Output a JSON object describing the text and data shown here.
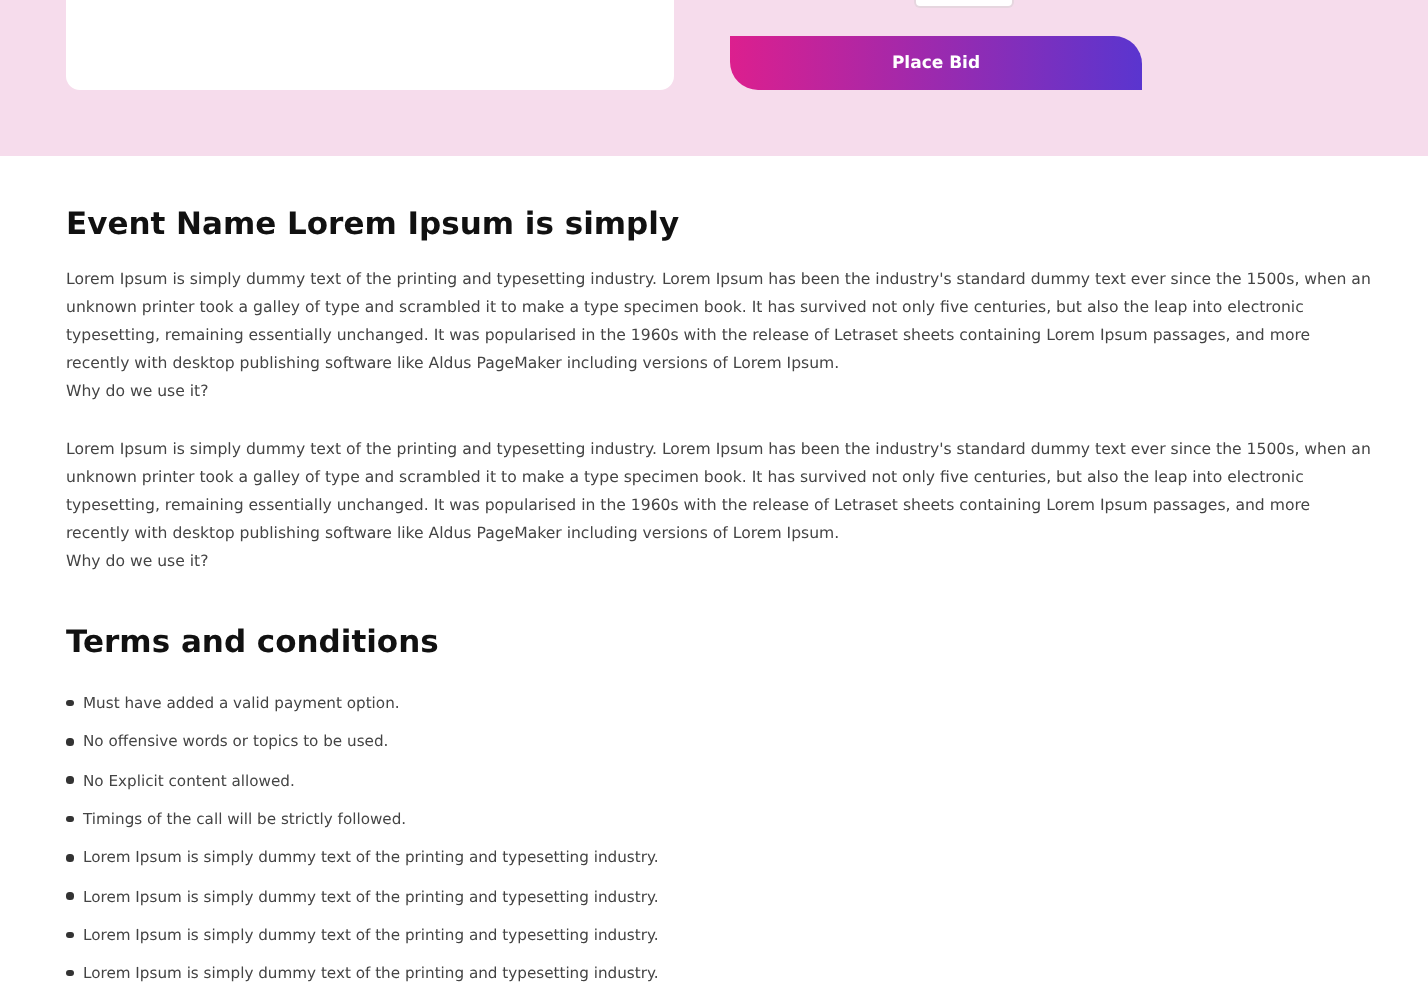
{
  "bid_panel": {
    "button": "Place Bid"
  },
  "event": {
    "title": "Event Name Lorem Ipsum is simply",
    "paragraphs": [
      {
        "text": "Lorem Ipsum is simply dummy text of the printing and typesetting industry. Lorem Ipsum has been the industry's standard dummy text ever since the 1500s, when an unknown printer took a galley of type and scrambled it to make a type specimen book. It has survived not only five centuries, but also the leap into electronic typesetting, remaining essentially unchanged. It was popularised in the 1960s with the release of Letraset sheets containing Lorem Ipsum passages, and more recently with desktop publishing software like Aldus PageMaker including versions of Lorem Ipsum.",
        "question": "Why do we use it?"
      },
      {
        "text": "Lorem Ipsum is simply dummy text of the printing and typesetting industry. Lorem Ipsum has been the industry's standard dummy text ever since the 1500s, when an unknown printer took a galley of type and scrambled it to make a type specimen book. It has survived not only five centuries, but also the leap into electronic typesetting, remaining essentially unchanged. It was popularised in the 1960s with the release of Letraset sheets containing Lorem Ipsum passages, and more recently with desktop publishing software like Aldus PageMaker including versions of Lorem Ipsum.",
        "question": "Why do we use it?"
      }
    ]
  },
  "terms": {
    "title": "Terms and conditions",
    "items": [
      "Must have added a valid payment option.",
      "No offensive words or topics to be used.",
      "No Explicit content allowed.",
      "Timings of the call will be strictly followed.",
      "Lorem Ipsum is simply dummy text of the printing and typesetting industry.",
      "Lorem Ipsum is simply dummy text of the printing and typesetting industry.",
      "Lorem Ipsum is simply dummy text of the printing and typesetting industry.",
      "Lorem Ipsum is simply dummy text of the printing and typesetting industry."
    ]
  }
}
